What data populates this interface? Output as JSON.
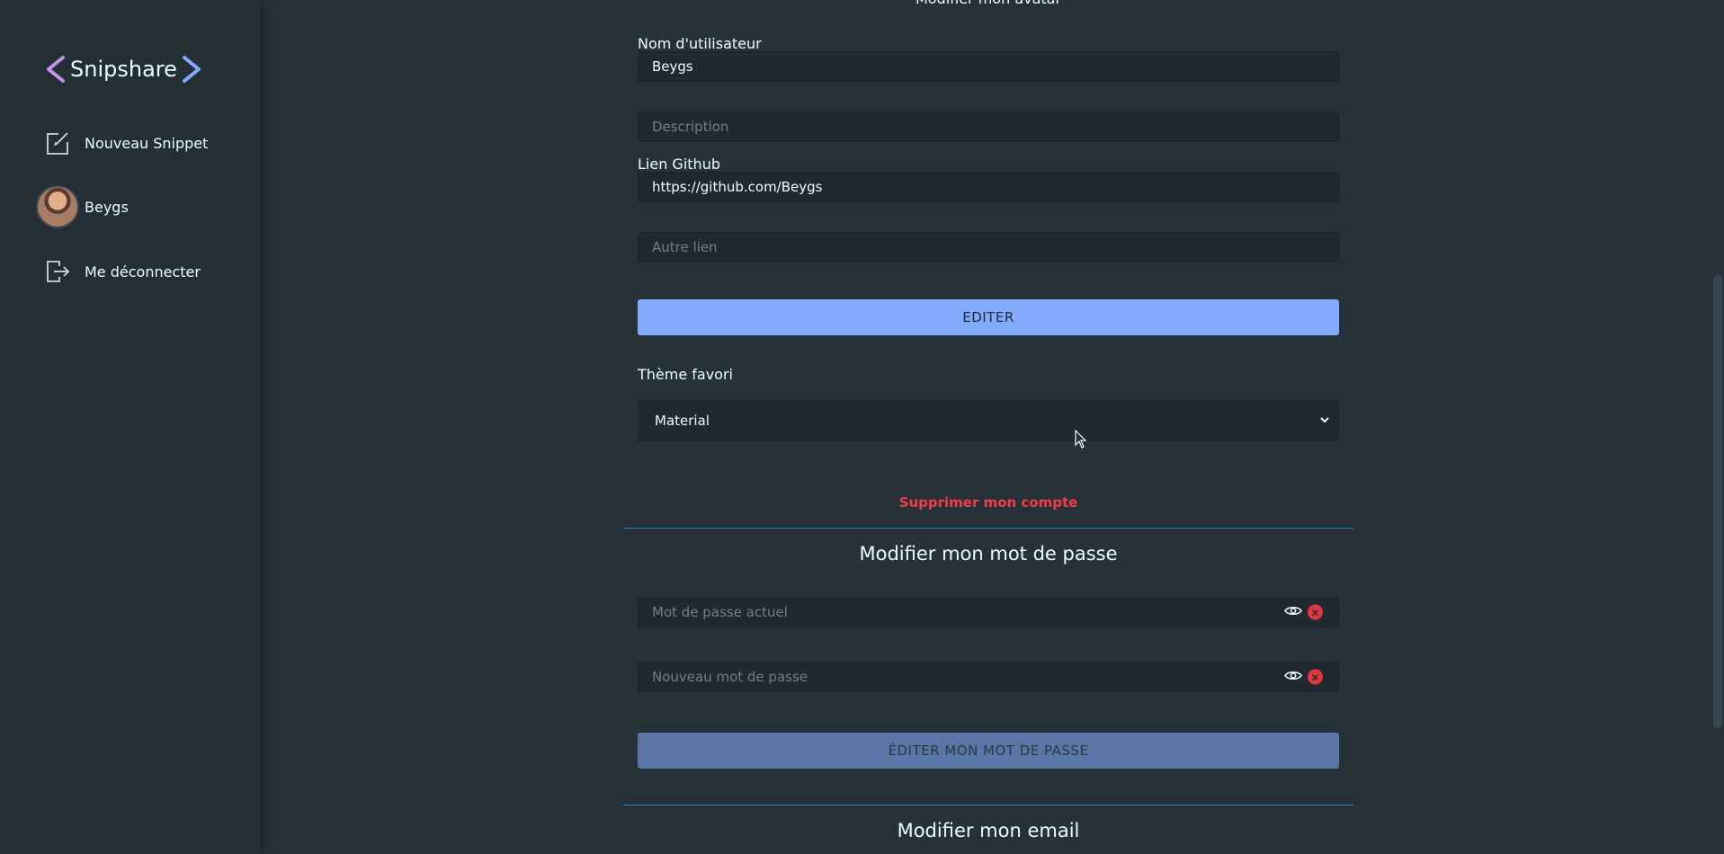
{
  "sidebar": {
    "logo_text": "Snipshare",
    "logo_colors": {
      "left_chevron": "#c792ea",
      "right_chevron": "#82aaff"
    },
    "items": [
      {
        "label": "Nouveau Snippet",
        "icon": "edit-icon"
      },
      {
        "label": "Beygs",
        "icon": "avatar"
      },
      {
        "label": "Me déconnecter",
        "icon": "logout-icon"
      }
    ]
  },
  "profile": {
    "top_cut_label": "Modifier mon avatar",
    "username_label": "Nom d'utilisateur",
    "username_value": "Beygs",
    "description_placeholder": "Description",
    "github_label": "Lien Github",
    "github_value": "https://github.com/Beygs",
    "other_link_placeholder": "Autre lien",
    "edit_button": "EDITER",
    "theme_label": "Thème favori",
    "theme_selected": "Material",
    "delete_account": "Supprimer mon compte"
  },
  "password": {
    "title": "Modifier mon mot de passe",
    "current_placeholder": "Mot de passe actuel",
    "new_placeholder": "Nouveau mot de passe",
    "submit_button": "ÉDITER MON MOT DE PASSE"
  },
  "email": {
    "title": "Modifier mon email"
  },
  "colors": {
    "background": "#263238",
    "sidebar": "#232f35",
    "accent": "#82aaff",
    "danger": "#f03c4c",
    "divider": "#2c89c6"
  }
}
